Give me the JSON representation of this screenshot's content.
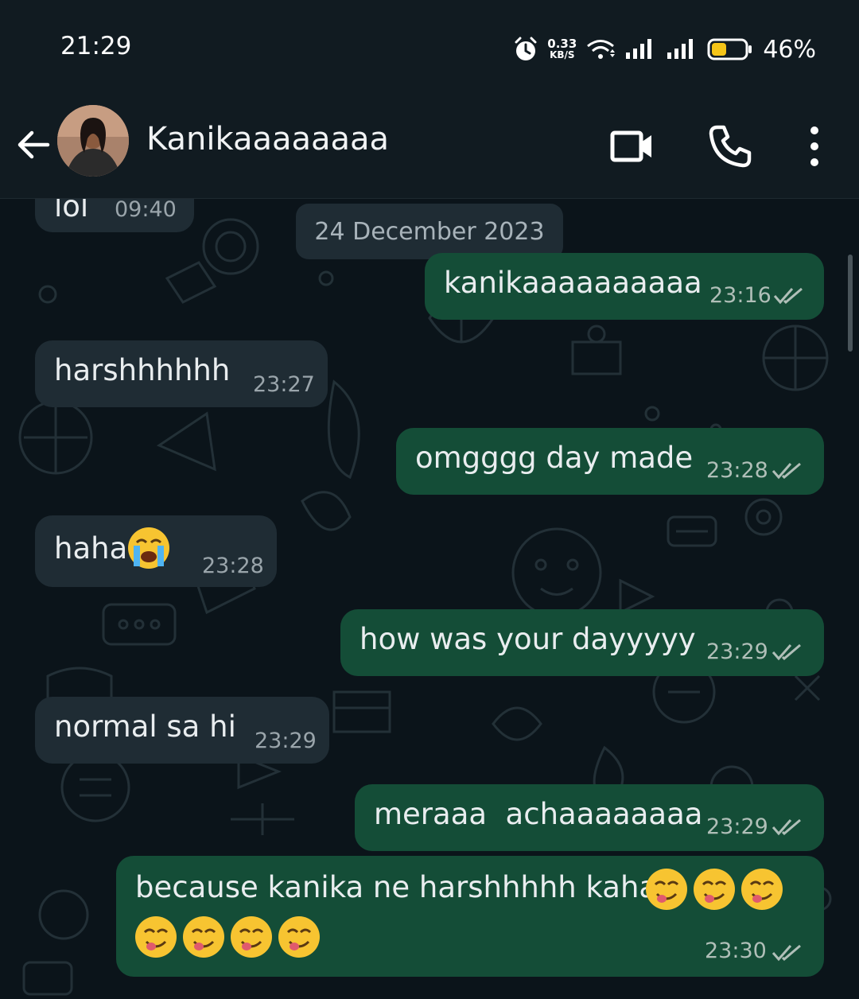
{
  "status_bar": {
    "time": "21:29",
    "speed_value": "0.33",
    "speed_unit": "KB/S",
    "battery_percent": "46%",
    "battery_level": 0.46
  },
  "header": {
    "contact_name": "Kanikaaaaaaaa",
    "icons": [
      "back-arrow-icon",
      "video-call-icon",
      "phone-icon",
      "more-vert-icon"
    ]
  },
  "chat": {
    "previous_message": {
      "text": "lol",
      "time": "09:40"
    },
    "date_divider": "24 December 2023",
    "messages": [
      {
        "direction": "outgoing",
        "text": "kanikaaaaaaaaaa",
        "time": "23:16",
        "status": "read"
      },
      {
        "direction": "incoming",
        "text": "harshhhhhh",
        "time": "23:27"
      },
      {
        "direction": "outgoing",
        "text": "omgggg day made",
        "time": "23:28",
        "status": "read"
      },
      {
        "direction": "incoming",
        "text": "haha",
        "emoji": "😭",
        "time": "23:28"
      },
      {
        "direction": "outgoing",
        "text": "how was your dayyyyy",
        "time": "23:29",
        "status": "read"
      },
      {
        "direction": "incoming",
        "text": "normal sa hi",
        "time": "23:29"
      },
      {
        "direction": "outgoing",
        "text": "meraaa  achaaaaaaaa",
        "time": "23:29",
        "status": "read"
      },
      {
        "direction": "outgoing",
        "text": "because kanika ne harshhhhh kaha",
        "emoji_line1": "😋😋😋",
        "emoji_line2": "😋😋😋😋",
        "time": "23:30",
        "status": "read"
      }
    ]
  },
  "colors": {
    "background": "#0b141a",
    "header": "#111b21",
    "incoming_bubble": "#1f2c34",
    "outgoing_bubble": "#144d37",
    "battery_fill": "#f5c518"
  }
}
